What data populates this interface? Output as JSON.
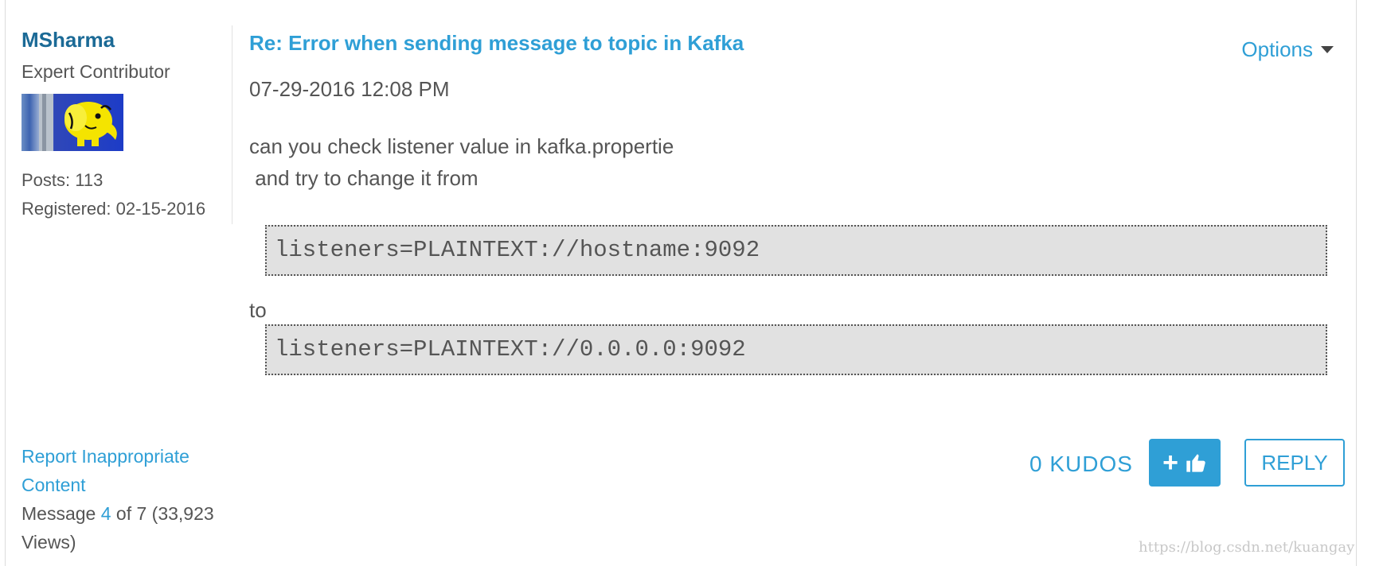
{
  "author": {
    "name": "MSharma",
    "rank": "Expert Contributor",
    "posts_label": "Posts: 113",
    "registered_label": "Registered: 02-15-2016"
  },
  "post": {
    "subject": "Re: Error when sending message to topic in Kafka",
    "options_label": "Options",
    "date": "07-29-2016 12:08 PM",
    "body_line1": "can you check listener value in kafka.propertie",
    "body_line2": " and try to change it from",
    "code_from": "listeners=PLAINTEXT://hostname:9092",
    "to_word": "to",
    "code_to": "listeners=PLAINTEXT://0.0.0.0:9092"
  },
  "footer": {
    "report_label": "Report Inappropriate Content",
    "message_prefix": "Message ",
    "message_number": "4",
    "message_suffix": " of 7 (33,923 Views)",
    "kudos_label": "0 KUDOS",
    "kudo_button_plus": "+",
    "reply_label": "REPLY"
  },
  "watermark": "https://blog.csdn.net/kuangay",
  "icons": {
    "options_caret": "chevron-down-icon",
    "kudo": "thumbs-up-icon",
    "avatar": "hadoop-elephant"
  },
  "colors": {
    "link_blue": "#2f9fd6",
    "author_blue": "#1b6a96",
    "code_bg": "#e1e1e1",
    "text": "#555555"
  }
}
